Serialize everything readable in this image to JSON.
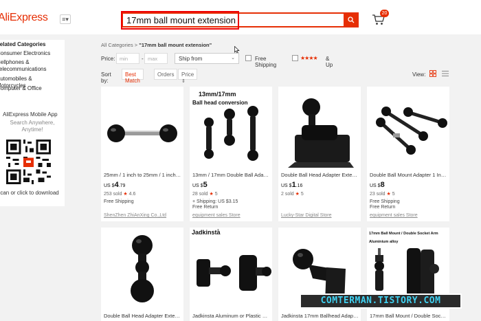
{
  "header": {
    "logo": "AliExpress",
    "menu_icon": "menu-icon",
    "search_value": "17mm ball mount extension",
    "search_icon": "search-icon",
    "cart_icon": "cart-icon",
    "cart_count": "20",
    "brand_color": "#e62e04"
  },
  "sidebar": {
    "title": "Related Categories",
    "categories": [
      "Consumer Electronics",
      "Cellphones & Telecommunications",
      "Automobiles & Motorcycles",
      "Computer & Office"
    ],
    "app_title": "AliExpress Mobile App",
    "app_sub": "Search Anywhere, Anytime!",
    "scan_text": "Scan or click to download"
  },
  "breadcrumb": {
    "root": "All Categories",
    "sep": ">",
    "current": "\"17mm ball mount extension\""
  },
  "filters": {
    "price_label": "Price:",
    "min_placeholder": "min",
    "dash": "-",
    "max_placeholder": "max",
    "ship_from": "Ship from",
    "free_shipping": "Free Shipping",
    "stars": "★★★★",
    "and_up": "& Up"
  },
  "sort": {
    "label": "Sort by:",
    "options": [
      "Best Match",
      "Orders",
      "Price"
    ],
    "active": "Best Match"
  },
  "view": {
    "label": "View:"
  },
  "products": [
    {
      "title": "25mm / 1 inch to 25mm / 1 inch C...",
      "currency": "US $",
      "whole": "4",
      "frac": ".79",
      "sold": "253 sold",
      "rating": "4.6",
      "line1": "Free Shipping",
      "line2": "",
      "store": "ShenZhen ZhiAnXing Co.,Ltd"
    },
    {
      "title": "13mm / 17mm Double Ball Adapte...",
      "currency": "US $",
      "whole": "5",
      "frac": "",
      "sold": "28 sold",
      "rating": "5",
      "line1": "+ Shipping: US $3.15",
      "line2": "Free Return",
      "store": "equipment sales Store",
      "img_caption_1": "13mm/17mm",
      "img_caption_2": "Ball head conversion"
    },
    {
      "title": "Double Ball Head Adapter Extensi...",
      "currency": "US $",
      "whole": "1",
      "frac": ".16",
      "sold": "2 sold",
      "rating": "5",
      "line1": "",
      "line2": "",
      "store": "Lucky-Star Digital Store"
    },
    {
      "title": "Double Ball Mount Adapter 1 Inch ...",
      "currency": "US $",
      "whole": "8",
      "frac": "",
      "sold": "23 sold",
      "rating": "5",
      "line1": "Free Shipping",
      "line2": "Free Return",
      "store": "equipment sales Store"
    },
    {
      "title": "Double Ball Head Adapter Extensi...",
      "currency": "",
      "whole": "",
      "frac": "",
      "sold": "",
      "rating": "",
      "line1": "",
      "line2": "",
      "store": ""
    },
    {
      "title": "Jadkinsta Aluminum or Plastic Dou...",
      "currency": "",
      "whole": "",
      "frac": "",
      "sold": "",
      "rating": "",
      "line1": "",
      "line2": "",
      "store": "",
      "img_caption_1": "Jadkinsta",
      "img_caption_2": "®"
    },
    {
      "title": "Jadkinsta 17mm Ballhead Adapter...",
      "currency": "",
      "whole": "",
      "frac": "",
      "sold": "",
      "rating": "",
      "line1": "",
      "line2": "",
      "store": ""
    },
    {
      "title": "17mm Ball Mount / Double Socket A...",
      "currency": "",
      "whole": "",
      "frac": "",
      "sold": "",
      "rating": "",
      "line1": "",
      "line2": "",
      "store": "",
      "img_caption_1": "17mm Ball Mount / Double Socket Arm",
      "img_caption_2": "Aluminium alloy"
    }
  ],
  "watermark": "COMTERMAN.TISTORY.COM"
}
